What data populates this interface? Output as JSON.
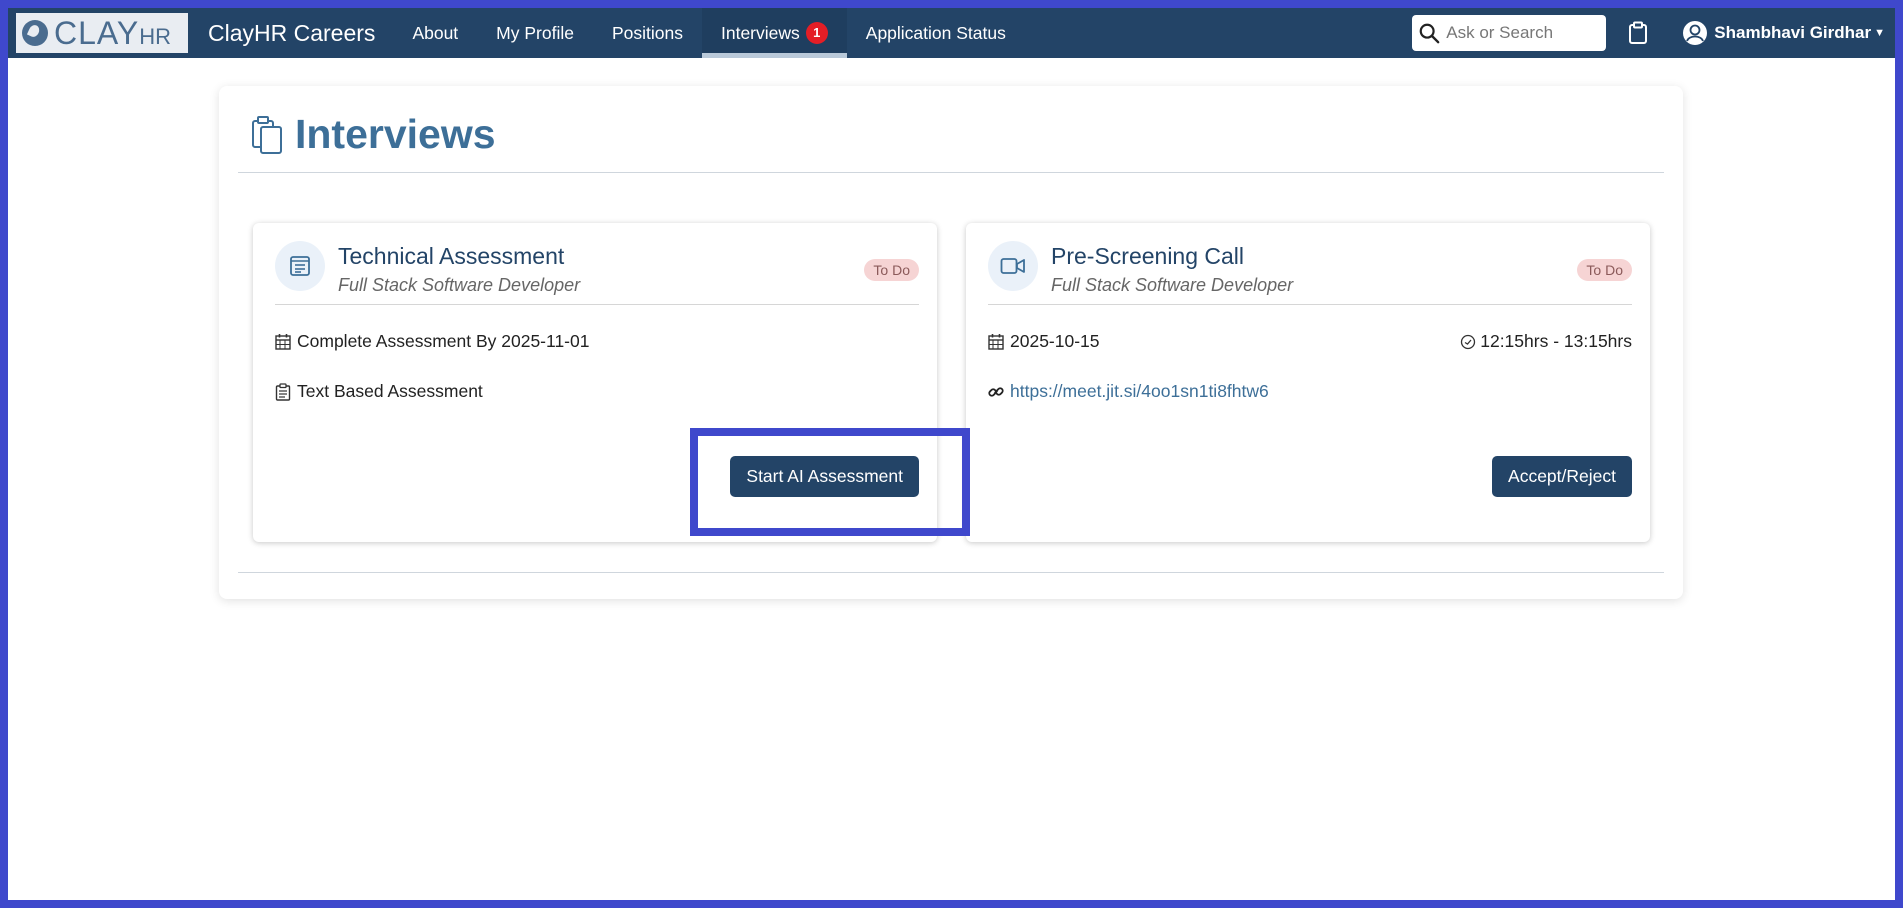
{
  "navbar": {
    "logo_main": "CLAY",
    "logo_suffix": "HR",
    "brand": "ClayHR Careers",
    "items": [
      {
        "label": "About"
      },
      {
        "label": "My Profile"
      },
      {
        "label": "Positions"
      },
      {
        "label": "Interviews",
        "badge": "1",
        "active": true
      },
      {
        "label": "Application Status"
      }
    ],
    "search_placeholder": "Ask or Search",
    "user_name": "Shambhavi Girdhar"
  },
  "page": {
    "title": "Interviews",
    "cards": [
      {
        "title": "Technical Assessment",
        "subtitle": "Full Stack Software Developer",
        "status": "To Do",
        "detail_1": "Complete Assessment By 2025-11-01",
        "detail_2": "Text Based Assessment",
        "button": "Start AI Assessment"
      },
      {
        "title": "Pre-Screening Call",
        "subtitle": "Full Stack Software Developer",
        "status": "To Do",
        "date": "2025-10-15",
        "time": "12:15hrs - 13:15hrs",
        "link": "https://meet.jit.si/4oo1sn1ti8fhtw6",
        "button": "Accept/Reject"
      }
    ]
  },
  "colors": {
    "navbar_bg": "#234467",
    "accent": "#3d6f98",
    "highlight_border": "#3f48cc",
    "badge": "#e41e26"
  }
}
